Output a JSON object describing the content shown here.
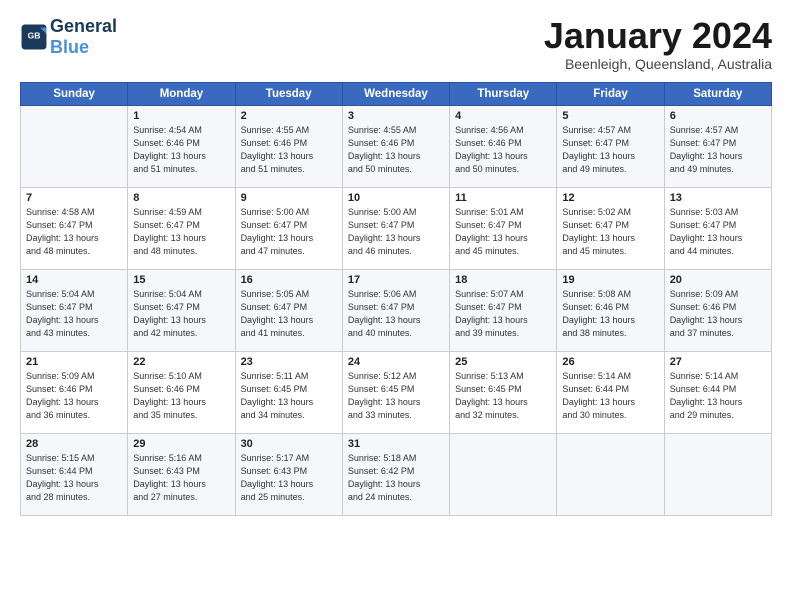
{
  "header": {
    "logo_line1": "General",
    "logo_line2": "Blue",
    "month": "January 2024",
    "location": "Beenleigh, Queensland, Australia"
  },
  "days_of_week": [
    "Sunday",
    "Monday",
    "Tuesday",
    "Wednesday",
    "Thursday",
    "Friday",
    "Saturday"
  ],
  "weeks": [
    [
      {
        "day": "",
        "info": ""
      },
      {
        "day": "1",
        "info": "Sunrise: 4:54 AM\nSunset: 6:46 PM\nDaylight: 13 hours\nand 51 minutes."
      },
      {
        "day": "2",
        "info": "Sunrise: 4:55 AM\nSunset: 6:46 PM\nDaylight: 13 hours\nand 51 minutes."
      },
      {
        "day": "3",
        "info": "Sunrise: 4:55 AM\nSunset: 6:46 PM\nDaylight: 13 hours\nand 50 minutes."
      },
      {
        "day": "4",
        "info": "Sunrise: 4:56 AM\nSunset: 6:46 PM\nDaylight: 13 hours\nand 50 minutes."
      },
      {
        "day": "5",
        "info": "Sunrise: 4:57 AM\nSunset: 6:47 PM\nDaylight: 13 hours\nand 49 minutes."
      },
      {
        "day": "6",
        "info": "Sunrise: 4:57 AM\nSunset: 6:47 PM\nDaylight: 13 hours\nand 49 minutes."
      }
    ],
    [
      {
        "day": "7",
        "info": "Sunrise: 4:58 AM\nSunset: 6:47 PM\nDaylight: 13 hours\nand 48 minutes."
      },
      {
        "day": "8",
        "info": "Sunrise: 4:59 AM\nSunset: 6:47 PM\nDaylight: 13 hours\nand 48 minutes."
      },
      {
        "day": "9",
        "info": "Sunrise: 5:00 AM\nSunset: 6:47 PM\nDaylight: 13 hours\nand 47 minutes."
      },
      {
        "day": "10",
        "info": "Sunrise: 5:00 AM\nSunset: 6:47 PM\nDaylight: 13 hours\nand 46 minutes."
      },
      {
        "day": "11",
        "info": "Sunrise: 5:01 AM\nSunset: 6:47 PM\nDaylight: 13 hours\nand 45 minutes."
      },
      {
        "day": "12",
        "info": "Sunrise: 5:02 AM\nSunset: 6:47 PM\nDaylight: 13 hours\nand 45 minutes."
      },
      {
        "day": "13",
        "info": "Sunrise: 5:03 AM\nSunset: 6:47 PM\nDaylight: 13 hours\nand 44 minutes."
      }
    ],
    [
      {
        "day": "14",
        "info": "Sunrise: 5:04 AM\nSunset: 6:47 PM\nDaylight: 13 hours\nand 43 minutes."
      },
      {
        "day": "15",
        "info": "Sunrise: 5:04 AM\nSunset: 6:47 PM\nDaylight: 13 hours\nand 42 minutes."
      },
      {
        "day": "16",
        "info": "Sunrise: 5:05 AM\nSunset: 6:47 PM\nDaylight: 13 hours\nand 41 minutes."
      },
      {
        "day": "17",
        "info": "Sunrise: 5:06 AM\nSunset: 6:47 PM\nDaylight: 13 hours\nand 40 minutes."
      },
      {
        "day": "18",
        "info": "Sunrise: 5:07 AM\nSunset: 6:47 PM\nDaylight: 13 hours\nand 39 minutes."
      },
      {
        "day": "19",
        "info": "Sunrise: 5:08 AM\nSunset: 6:46 PM\nDaylight: 13 hours\nand 38 minutes."
      },
      {
        "day": "20",
        "info": "Sunrise: 5:09 AM\nSunset: 6:46 PM\nDaylight: 13 hours\nand 37 minutes."
      }
    ],
    [
      {
        "day": "21",
        "info": "Sunrise: 5:09 AM\nSunset: 6:46 PM\nDaylight: 13 hours\nand 36 minutes."
      },
      {
        "day": "22",
        "info": "Sunrise: 5:10 AM\nSunset: 6:46 PM\nDaylight: 13 hours\nand 35 minutes."
      },
      {
        "day": "23",
        "info": "Sunrise: 5:11 AM\nSunset: 6:45 PM\nDaylight: 13 hours\nand 34 minutes."
      },
      {
        "day": "24",
        "info": "Sunrise: 5:12 AM\nSunset: 6:45 PM\nDaylight: 13 hours\nand 33 minutes."
      },
      {
        "day": "25",
        "info": "Sunrise: 5:13 AM\nSunset: 6:45 PM\nDaylight: 13 hours\nand 32 minutes."
      },
      {
        "day": "26",
        "info": "Sunrise: 5:14 AM\nSunset: 6:44 PM\nDaylight: 13 hours\nand 30 minutes."
      },
      {
        "day": "27",
        "info": "Sunrise: 5:14 AM\nSunset: 6:44 PM\nDaylight: 13 hours\nand 29 minutes."
      }
    ],
    [
      {
        "day": "28",
        "info": "Sunrise: 5:15 AM\nSunset: 6:44 PM\nDaylight: 13 hours\nand 28 minutes."
      },
      {
        "day": "29",
        "info": "Sunrise: 5:16 AM\nSunset: 6:43 PM\nDaylight: 13 hours\nand 27 minutes."
      },
      {
        "day": "30",
        "info": "Sunrise: 5:17 AM\nSunset: 6:43 PM\nDaylight: 13 hours\nand 25 minutes."
      },
      {
        "day": "31",
        "info": "Sunrise: 5:18 AM\nSunset: 6:42 PM\nDaylight: 13 hours\nand 24 minutes."
      },
      {
        "day": "",
        "info": ""
      },
      {
        "day": "",
        "info": ""
      },
      {
        "day": "",
        "info": ""
      }
    ]
  ]
}
